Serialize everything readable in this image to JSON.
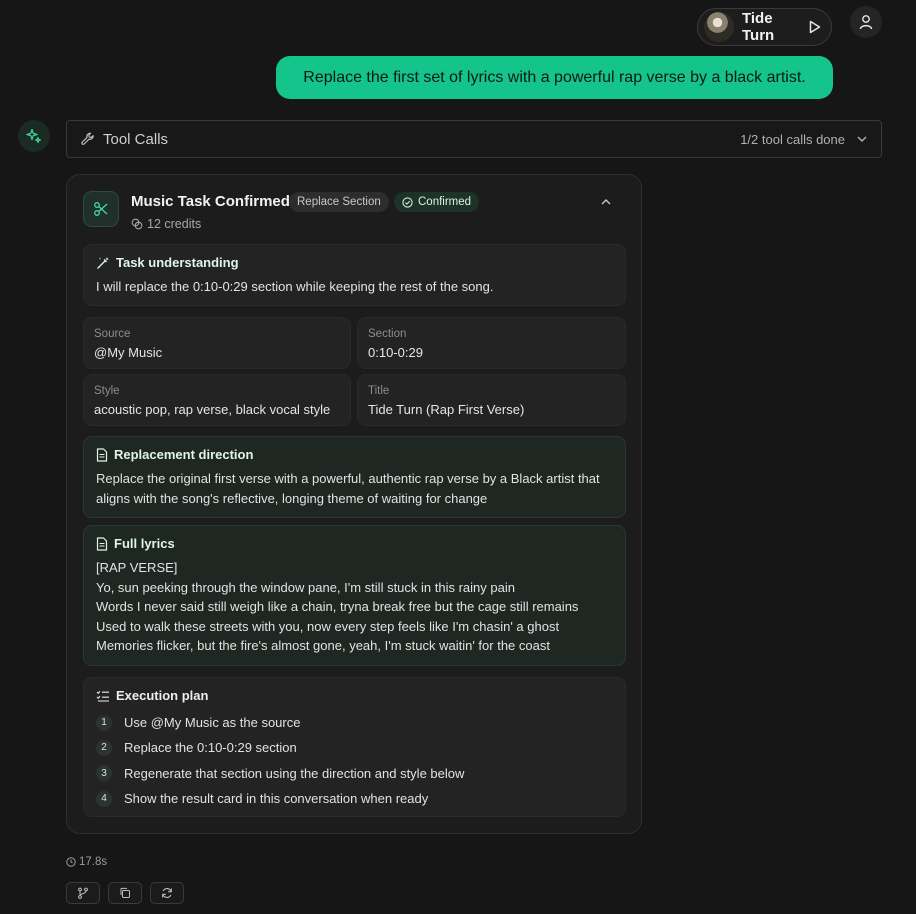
{
  "track": {
    "title": "Tide Turn"
  },
  "user_message": "Replace the first set of lyrics with a powerful rap verse by a black artist.",
  "tool_calls": {
    "label": "Tool Calls",
    "status": "1/2 tool calls done"
  },
  "card": {
    "title": "Music Task Confirmed",
    "badge_type": "Replace Section",
    "badge_status": "Confirmed",
    "credits": "12 credits",
    "task_understanding": {
      "heading": "Task understanding",
      "text": "I will replace the 0:10-0:29 section while keeping the rest of the song."
    },
    "fields": {
      "source": {
        "label": "Source",
        "value": "@My Music"
      },
      "section": {
        "label": "Section",
        "value": "0:10-0:29"
      },
      "style": {
        "label": "Style",
        "value": "acoustic pop, rap verse, black vocal style"
      },
      "title": {
        "label": "Title",
        "value": "Tide Turn (Rap First Verse)"
      }
    },
    "replacement_direction": {
      "heading": "Replacement direction",
      "text": "Replace the original first verse with a powerful, authentic rap verse by a Black artist that aligns with the song's reflective, longing theme of waiting for change"
    },
    "full_lyrics": {
      "heading": "Full lyrics",
      "lines": [
        "[RAP VERSE]",
        "Yo, sun peeking through the window pane, I'm still stuck in this rainy pain",
        "Words I never said still weigh like a chain, tryna break free but the cage still remains",
        "Used to walk these streets with you, now every step feels like I'm chasin' a ghost",
        "Memories flicker, but the fire's almost gone, yeah, I'm stuck waitin' for the coast"
      ]
    },
    "execution_plan": {
      "heading": "Execution plan",
      "steps": [
        {
          "num": "1",
          "text": "Use @My Music as the source"
        },
        {
          "num": "2",
          "text": "Replace the 0:10-0:29 section"
        },
        {
          "num": "3",
          "text": "Regenerate that section using the direction and style below"
        },
        {
          "num": "4",
          "text": "Show the result card in this conversation when ready"
        }
      ]
    }
  },
  "elapsed": "17.8s",
  "colors": {
    "accent": "#14c48a",
    "background": "#161616",
    "card": "#1c1c1c"
  },
  "icons": [
    "play-icon",
    "user-icon",
    "sparkle-icon",
    "wrench-icon",
    "chevron-down-icon",
    "scissors-icon",
    "check-circle-icon",
    "coins-icon",
    "chevron-up-icon",
    "wand-icon",
    "document-icon",
    "list-check-icon",
    "clock-icon",
    "branch-icon",
    "copy-icon",
    "refresh-icon"
  ]
}
